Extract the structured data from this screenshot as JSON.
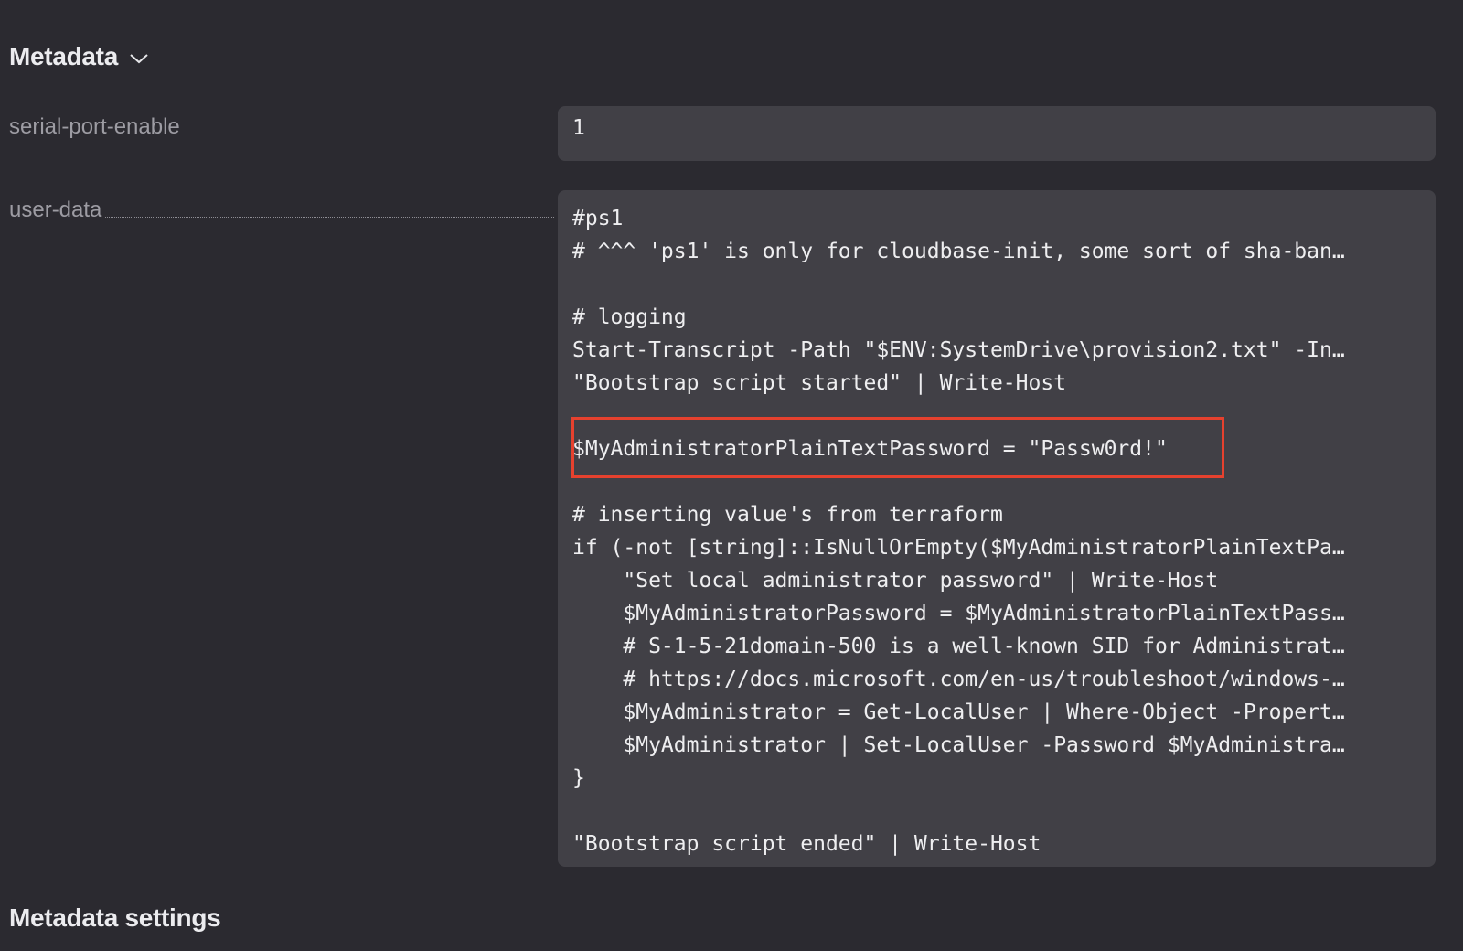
{
  "metadata": {
    "title": "Metadata",
    "chevron_icon": "chevron-down-icon"
  },
  "fields": {
    "serial_port_enable": {
      "label": "serial-port-enable",
      "value": "1"
    },
    "user_data": {
      "label": "user-data",
      "lines": [
        "#ps1",
        "# ^^^ 'ps1' is only for cloudbase-init, some sort of sha-ban…",
        "",
        "# logging",
        "Start-Transcript -Path \"$ENV:SystemDrive\\provision2.txt\" -In…",
        "\"Bootstrap script started\" | Write-Host",
        "",
        "$MyAdministratorPlainTextPassword = \"Passw0rd!\"",
        "",
        "# inserting value's from terraform",
        "if (-not [string]::IsNullOrEmpty($MyAdministratorPlainTextPa…",
        "    \"Set local administrator password\" | Write-Host",
        "    $MyAdministratorPassword = $MyAdministratorPlainTextPass…",
        "    # S-1-5-21domain-500 is a well-known SID for Administrat…",
        "    # https://docs.microsoft.com/en-us/troubleshoot/windows-…",
        "    $MyAdministrator = Get-LocalUser | Where-Object -Propert…",
        "    $MyAdministrator | Set-LocalUser -Password $MyAdministra…",
        "}",
        "",
        "\"Bootstrap script ended\" | Write-Host"
      ]
    }
  },
  "metadata_settings": {
    "title": "Metadata settings"
  },
  "colors": {
    "background": "#2b2a30",
    "field_background": "#414046",
    "highlight_border": "#e5412e"
  }
}
